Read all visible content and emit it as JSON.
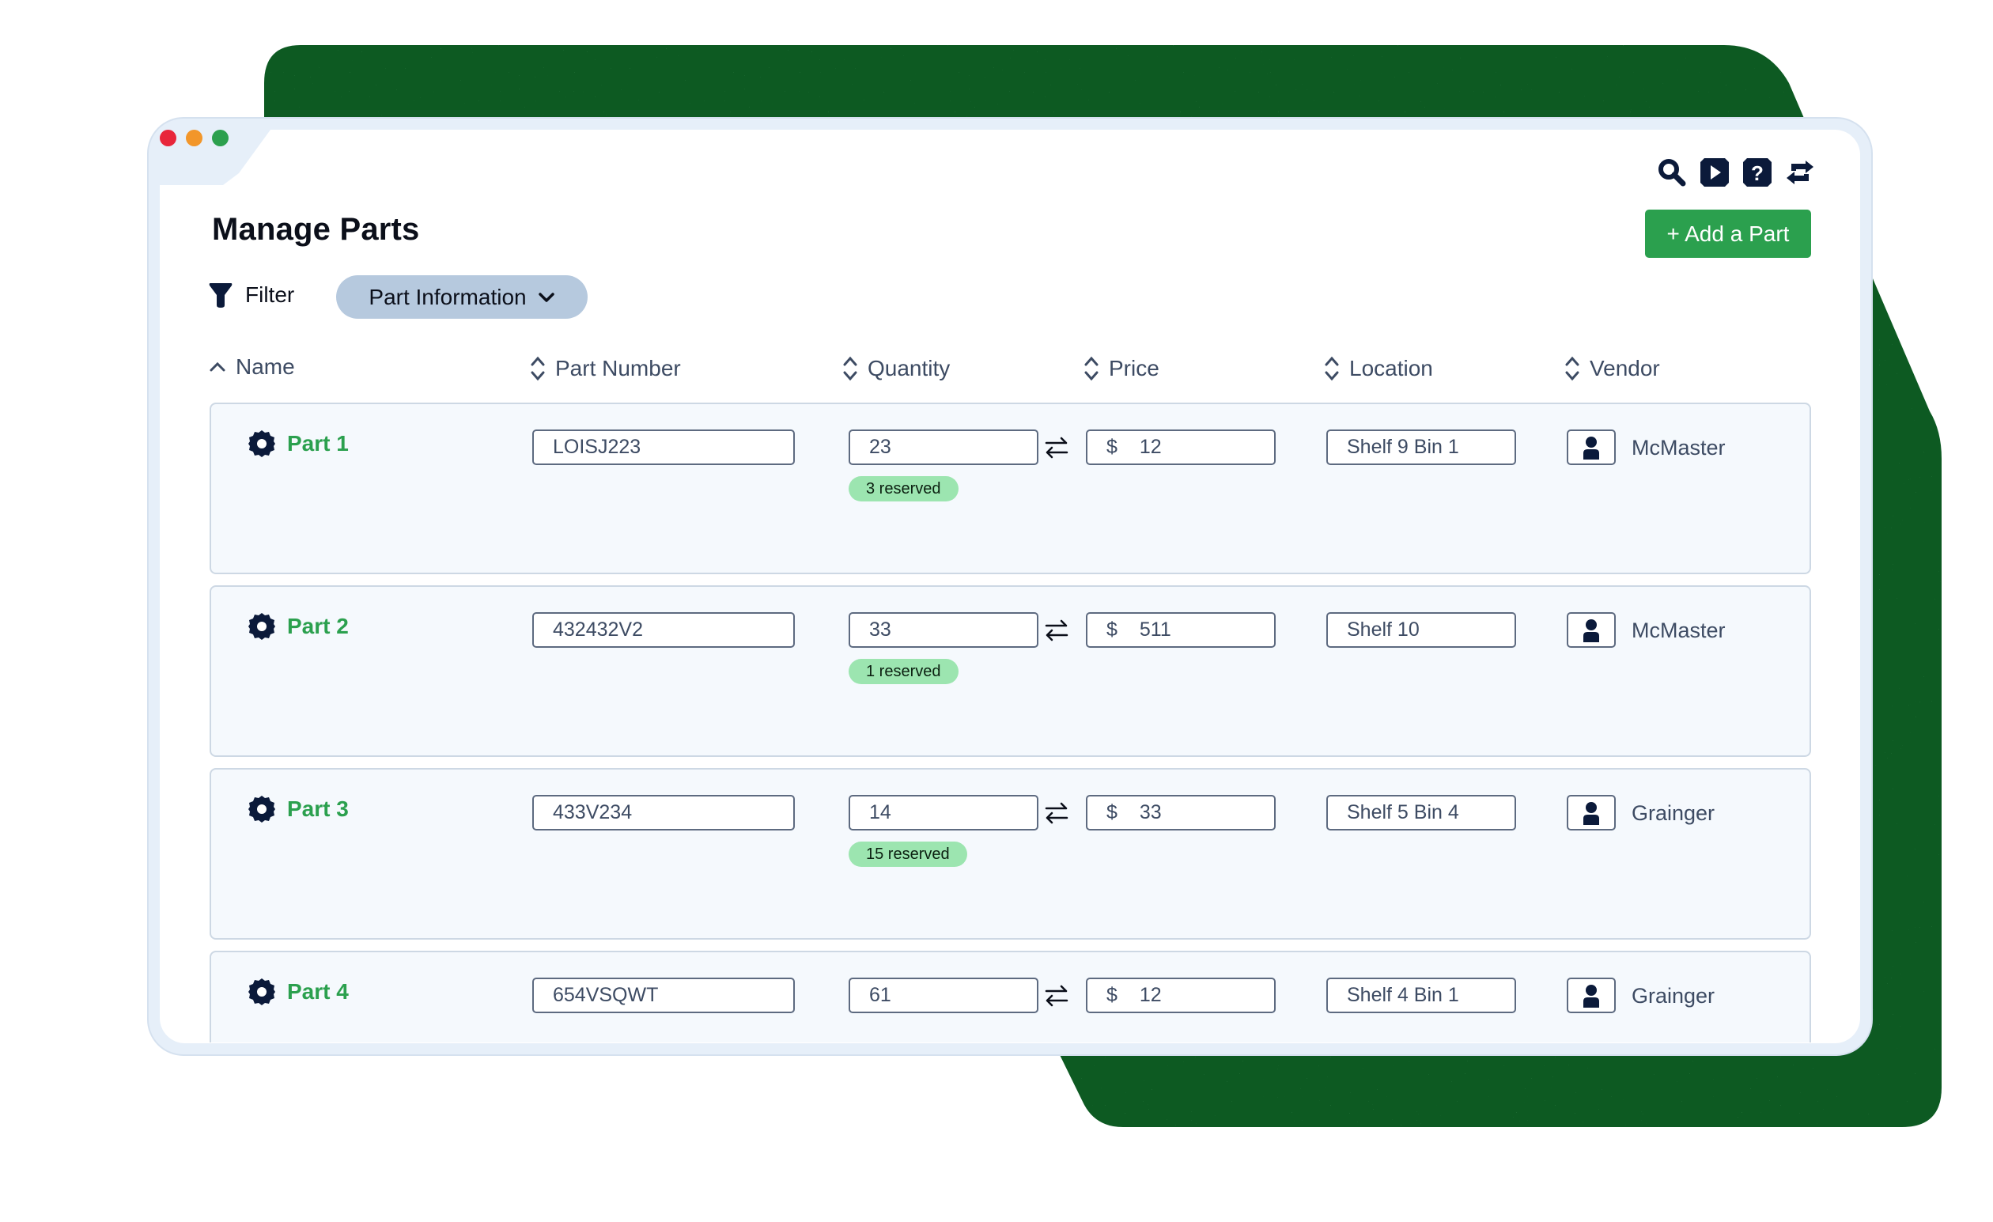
{
  "window": {
    "controls": [
      {
        "name": "close",
        "color": "#e8263b"
      },
      {
        "name": "minimize",
        "color": "#f2962a"
      },
      {
        "name": "maximize",
        "color": "#2ca04e"
      }
    ]
  },
  "header": {
    "title": "Manage Parts",
    "add_button_label": "+ Add a Part",
    "toolbar_icons": [
      "search-icon",
      "video-icon",
      "help-icon",
      "refresh-icon"
    ]
  },
  "filter": {
    "label": "Filter",
    "chip_label": "Part Information"
  },
  "columns": [
    {
      "label": "Name",
      "sort": "ascending"
    },
    {
      "label": "Part Number",
      "sort": "none"
    },
    {
      "label": "Quantity",
      "sort": "none"
    },
    {
      "label": "Price",
      "sort": "none"
    },
    {
      "label": "Location",
      "sort": "none"
    },
    {
      "label": "Vendor",
      "sort": "none"
    }
  ],
  "currency_symbol": "$",
  "parts": [
    {
      "name": "Part 1",
      "part_number": "LOISJ223",
      "quantity": "23",
      "reserved": "3 reserved",
      "price": "12",
      "location": "Shelf 9 Bin 1",
      "vendor": "McMaster"
    },
    {
      "name": "Part 2",
      "part_number": "432432V2",
      "quantity": "33",
      "reserved": "1 reserved",
      "price": "511",
      "location": "Shelf 10",
      "vendor": "McMaster"
    },
    {
      "name": "Part 3",
      "part_number": "433V234",
      "quantity": "14",
      "reserved": "15 reserved",
      "price": "33",
      "location": "Shelf 5 Bin 4",
      "vendor": "Grainger"
    },
    {
      "name": "Part 4",
      "part_number": "654VSQWT",
      "quantity": "61",
      "reserved": null,
      "price": "12",
      "location": "Shelf 4 Bin 1",
      "vendor": "Grainger"
    }
  ],
  "colors": {
    "accent_green": "#2ba04e",
    "dark_green_bg": "#0b5a23",
    "navy": "#0b1a3a",
    "chip_bg": "#b6c9de",
    "badge_bg": "#9ce5b0"
  }
}
